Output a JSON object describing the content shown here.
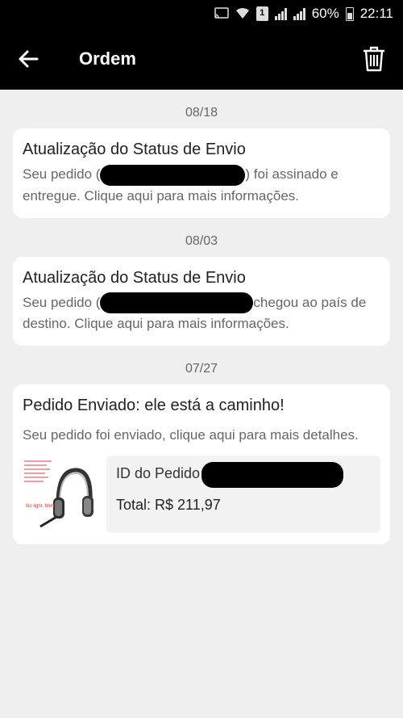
{
  "status_bar": {
    "battery": "60%",
    "time": "22:11",
    "sim_slot": "1"
  },
  "app_bar": {
    "title": "Ordem"
  },
  "notifications": [
    {
      "date": "08/18",
      "title": "Atualização do Status de Envio",
      "body_prefix": "Seu pedido (",
      "body_suffix": ") foi assinado e entregue. Clique aqui para mais informações."
    },
    {
      "date": "08/03",
      "title": "Atualização do Status de Envio",
      "body_prefix": "Seu pedido (",
      "body_suffix": "chegou ao país de destino. Clique aqui para mais informações."
    },
    {
      "date": "07/27",
      "title": "Pedido Enviado: ele está a caminho!",
      "body": "Seu pedido foi enviado, clique aqui para mais detalhes.",
      "order": {
        "id_label": "ID do Pedido",
        "total": "Total: R$ 211,97",
        "thumb_caption": "No light, Metal"
      }
    }
  ]
}
